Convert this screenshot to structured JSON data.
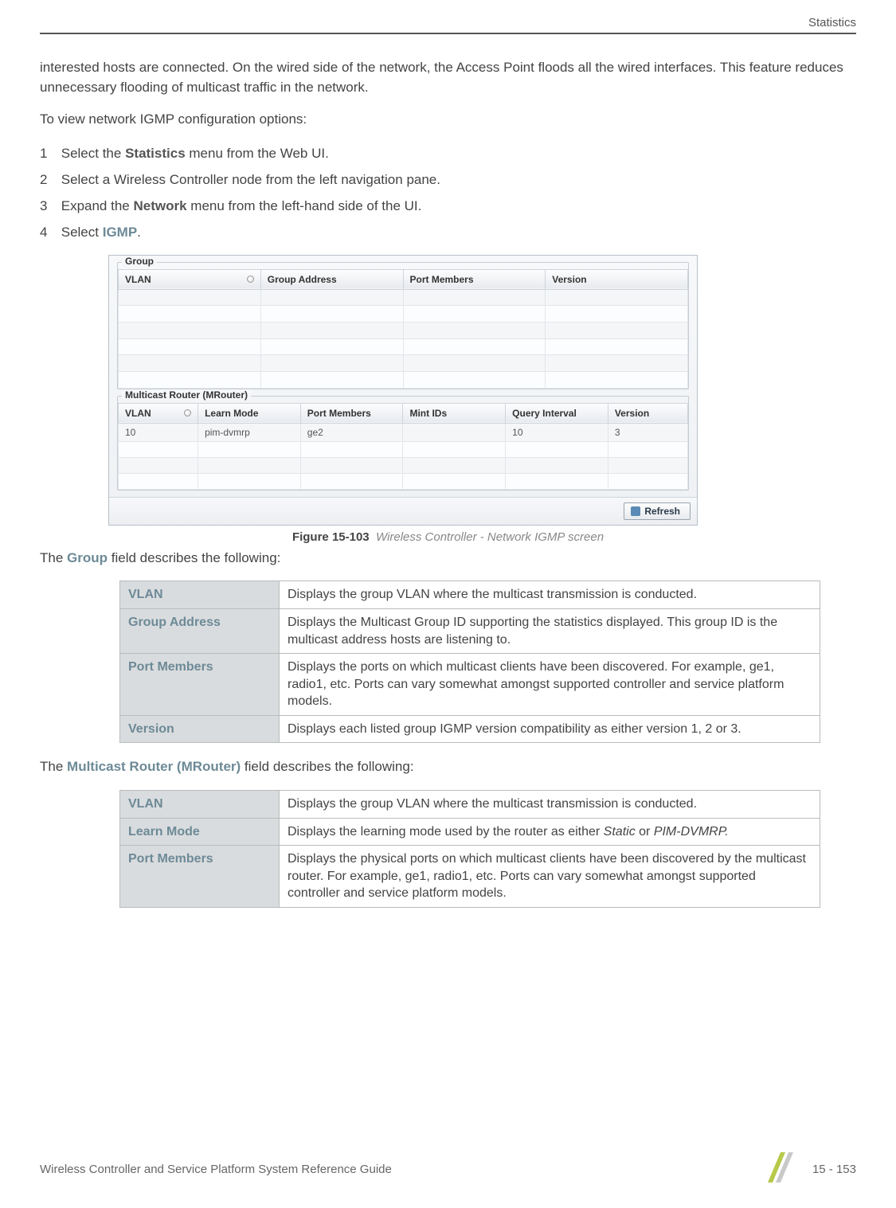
{
  "header": {
    "section": "Statistics"
  },
  "intro": {
    "para1": "interested hosts are connected. On the wired side of the network, the Access Point floods all the wired interfaces. This feature reduces unnecessary flooding of multicast traffic in the network.",
    "para2": "To view network IGMP configuration options:"
  },
  "steps": [
    {
      "num": "1",
      "pre": "Select the ",
      "bold": "Statistics",
      "post": " menu from the Web UI."
    },
    {
      "num": "2",
      "pre": "Select a Wireless Controller node from the left navigation pane.",
      "bold": "",
      "post": ""
    },
    {
      "num": "3",
      "pre": "Expand the ",
      "bold": "Network",
      "post": " menu from the left-hand side of the UI."
    },
    {
      "num": "4",
      "pre": "Select ",
      "bold": "IGMP",
      "post": "."
    }
  ],
  "shot": {
    "group": {
      "title": "Group",
      "cols": [
        "VLAN",
        "Group Address",
        "Port Members",
        "Version"
      ]
    },
    "mrouter": {
      "title": "Multicast Router (MRouter)",
      "cols": [
        "VLAN",
        "Learn Mode",
        "Port Members",
        "Mint IDs",
        "Query Interval",
        "Version"
      ],
      "rows": [
        {
          "vlan": "10",
          "learn": "pim-dvmrp",
          "ports": "ge2",
          "mint": "",
          "qint": "10",
          "ver": "3"
        }
      ]
    },
    "refresh": "Refresh"
  },
  "figure": {
    "label": "Figure 15-103",
    "desc": "Wireless Controller - Network IGMP screen"
  },
  "group_intro": {
    "pre": "The ",
    "bold": "Group",
    "post": " field describes the following:"
  },
  "group_fields": [
    {
      "name": "VLAN",
      "desc": "Displays the group VLAN where the multicast transmission is conducted."
    },
    {
      "name": "Group Address",
      "desc": "Displays the Multicast Group ID supporting the statistics displayed. This group ID is the multicast address hosts are listening to."
    },
    {
      "name": "Port Members",
      "desc": "Displays the ports on which multicast clients have been discovered. For example, ge1, radio1, etc. Ports can vary somewhat amongst supported controller and service platform models."
    },
    {
      "name": "Version",
      "desc": "Displays each listed group IGMP version compatibility as either version 1, 2 or 3."
    }
  ],
  "mrouter_intro": {
    "pre": "The ",
    "bold": "Multicast Router (MRouter)",
    "post": " field describes the following:"
  },
  "mrouter_fields": [
    {
      "name": "VLAN",
      "desc": "Displays the group VLAN where the multicast transmission is conducted."
    },
    {
      "name": "Learn Mode",
      "desc_pre": "Displays the learning mode used by the router as either ",
      "it1": "Static",
      "mid": " or ",
      "it2": "PIM-DVMRP.",
      "desc_post": ""
    },
    {
      "name": "Port Members",
      "desc": "Displays the physical ports on which multicast clients have been discovered by the multicast router. For example, ge1, radio1, etc. Ports can vary somewhat amongst supported controller and service platform models."
    }
  ],
  "footer": {
    "title": "Wireless Controller and Service Platform System Reference Guide",
    "page": "15 - 153"
  }
}
